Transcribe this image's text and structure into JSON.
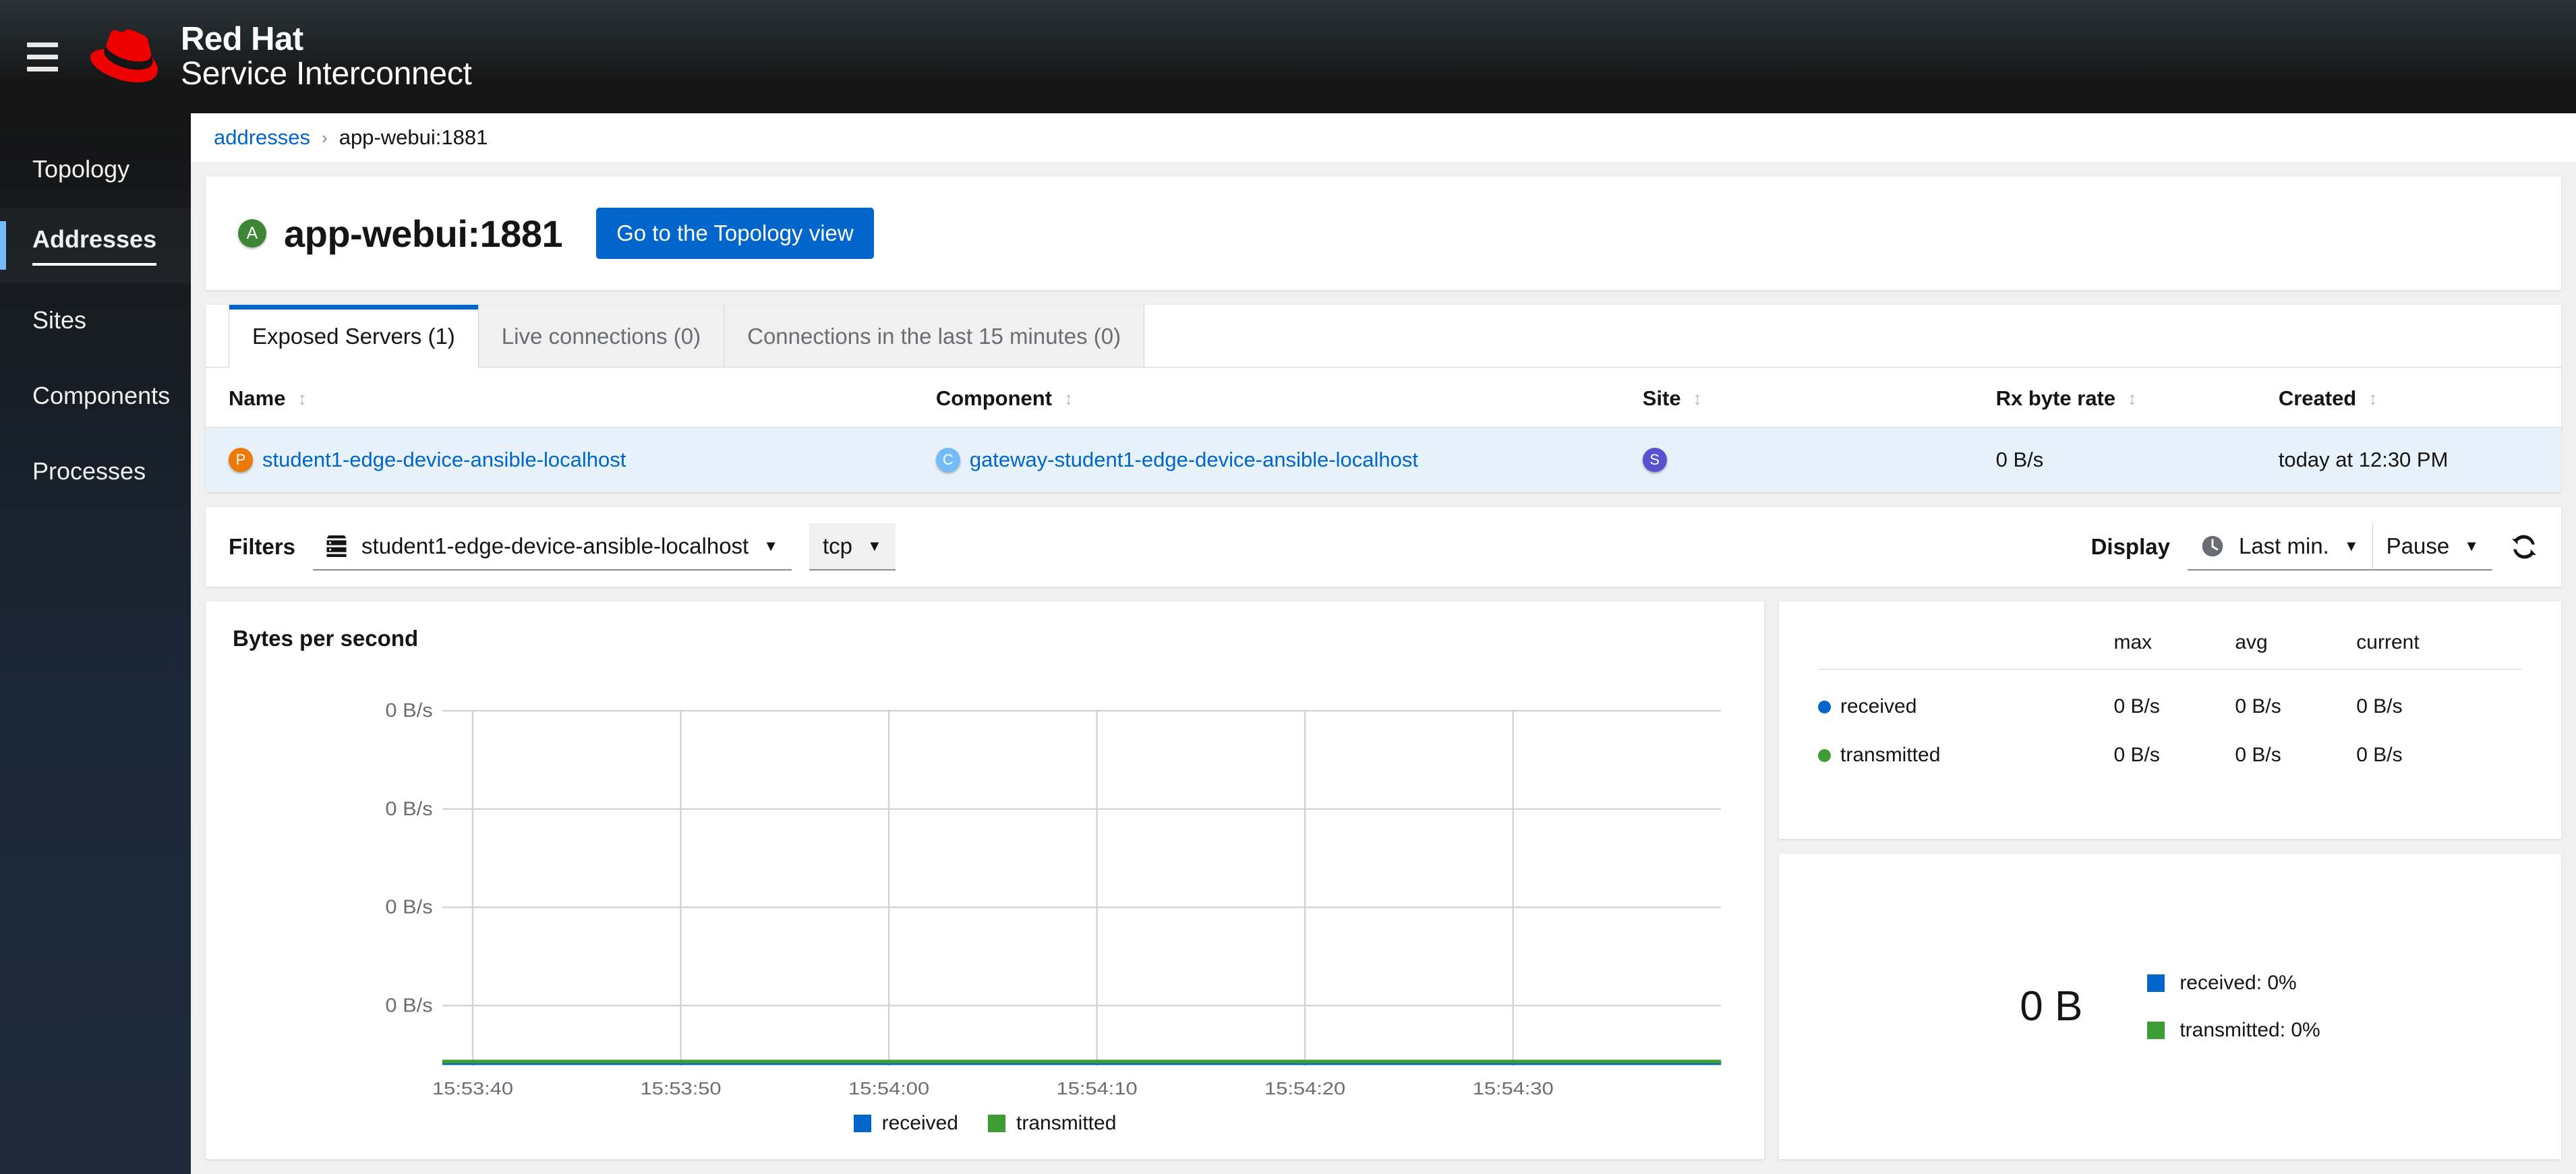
{
  "masthead": {
    "menu_icon": "hamburger-icon",
    "logo_icon": "red-hat-logo",
    "brand_line1": "Red Hat",
    "brand_line2": "Service Interconnect"
  },
  "sidebar": {
    "items": [
      {
        "label": "Topology",
        "active": false
      },
      {
        "label": "Addresses",
        "active": true
      },
      {
        "label": "Sites",
        "active": false
      },
      {
        "label": "Components",
        "active": false
      },
      {
        "label": "Processes",
        "active": false
      }
    ]
  },
  "breadcrumb": {
    "parent": "addresses",
    "separator": "›",
    "current": "app-webui:1881"
  },
  "page_header": {
    "badge": "A",
    "badge_color": "#3e8635",
    "title": "app-webui:1881",
    "action_button": "Go to the Topology view"
  },
  "tabs": [
    {
      "label": "Exposed Servers (1)",
      "active": true
    },
    {
      "label": "Live connections (0)",
      "active": false
    },
    {
      "label": "Connections in the last 15 minutes (0)",
      "active": false
    }
  ],
  "table": {
    "columns": [
      "Name",
      "Component",
      "Site",
      "Rx byte rate",
      "Created"
    ],
    "sort_icon": "sort-arrows-icon",
    "rows": [
      {
        "name_badge": "P",
        "name": "student1-edge-device-ansible-localhost",
        "component_badge": "C",
        "component": "gateway-student1-edge-device-ansible-localhost",
        "site_badge": "S",
        "site": "",
        "rx_byte_rate": "0 B/s",
        "created": "today at 12:30 PM"
      }
    ]
  },
  "filters": {
    "label": "Filters",
    "process_icon": "server-rack-icon",
    "process_select": "student1-edge-device-ansible-localhost",
    "protocol_select": "tcp",
    "caret_icon": "chevron-down-icon"
  },
  "display": {
    "label": "Display",
    "clock_icon": "clock-icon",
    "range_select": "Last min.",
    "state_select": "Pause",
    "refresh_icon": "refresh-icon"
  },
  "chart_data": {
    "type": "line",
    "title": "Bytes per second",
    "xlabel": "",
    "ylabel": "",
    "x": [
      "15:53:40",
      "15:53:50",
      "15:54:00",
      "15:54:10",
      "15:54:20",
      "15:54:30"
    ],
    "ytick_labels": [
      "0 B/s",
      "0 B/s",
      "0 B/s",
      "0 B/s"
    ],
    "ylim": [
      0,
      0
    ],
    "grid": true,
    "legend_position": "bottom",
    "series": [
      {
        "name": "received",
        "color": "#06c",
        "values": [
          0,
          0,
          0,
          0,
          0,
          0
        ]
      },
      {
        "name": "transmitted",
        "color": "#3e9c35",
        "values": [
          0,
          0,
          0,
          0,
          0,
          0
        ]
      }
    ]
  },
  "stats": {
    "columns": [
      "",
      "max",
      "avg",
      "current"
    ],
    "rows": [
      {
        "name": "received",
        "color": "#06c",
        "max": "0 B/s",
        "avg": "0 B/s",
        "current": "0 B/s"
      },
      {
        "name": "transmitted",
        "color": "#3e9c35",
        "max": "0 B/s",
        "avg": "0 B/s",
        "current": "0 B/s"
      }
    ]
  },
  "donut": {
    "total": "0 B",
    "legend": [
      {
        "label": "received: 0%",
        "color": "#06c"
      },
      {
        "label": "transmitted: 0%",
        "color": "#3e9c35"
      }
    ]
  }
}
